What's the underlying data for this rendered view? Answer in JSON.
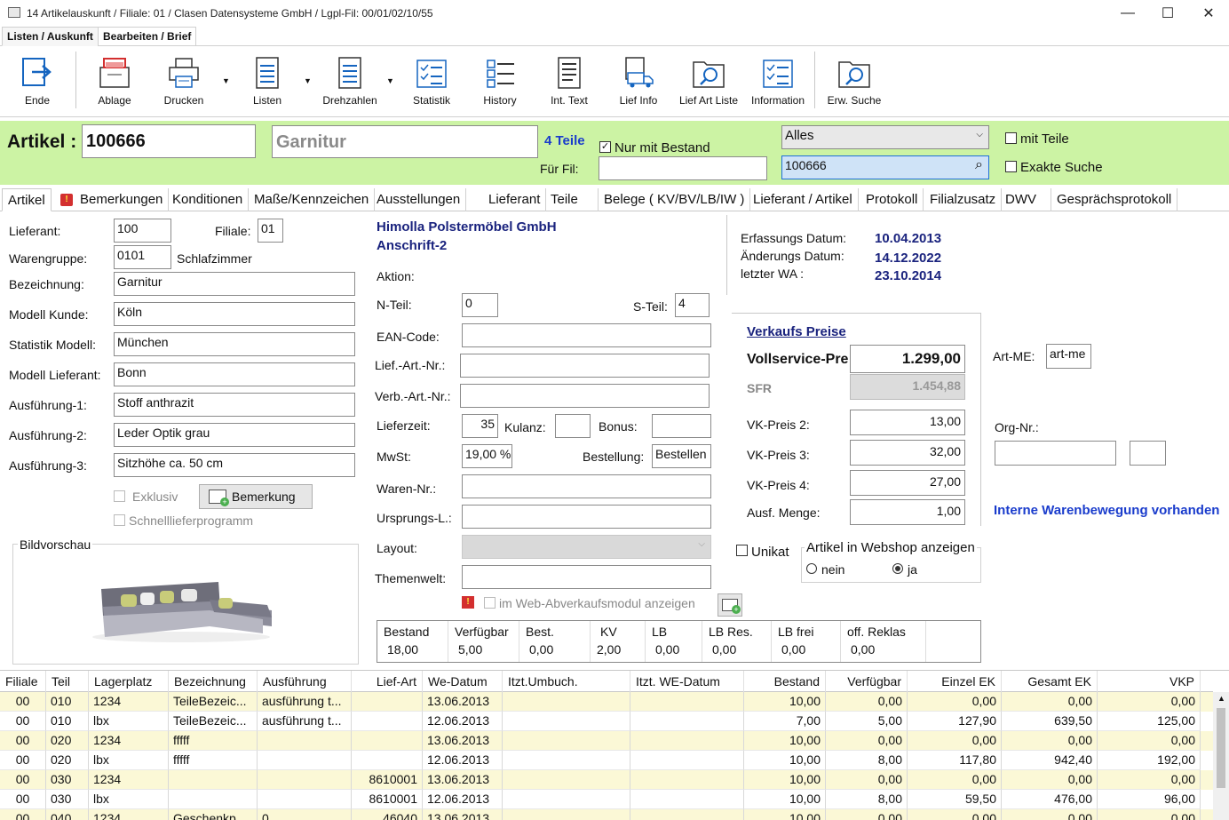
{
  "window": {
    "title": "14 Artikelauskunft / Filiale: 01 / Clasen Datensysteme GmbH / Lgpl-Fil: 00/01/02/10/55",
    "min": "—",
    "max": "☐",
    "close": "✕"
  },
  "ribbon_tabs": [
    "Listen / Auskunft",
    "Bearbeiten / Brief"
  ],
  "ribbon": {
    "ende": "Ende",
    "ablage": "Ablage",
    "drucken": "Drucken",
    "listen": "Listen",
    "drehzahlen": "Drehzahlen",
    "statistik": "Statistik",
    "history": "History",
    "int_text": "Int. Text",
    "lief_info": "Lief Info",
    "lief_art_liste": "Lief Art Liste",
    "information": "Information",
    "erw_suche": "Erw. Suche"
  },
  "header": {
    "artikel_label": "Artikel :",
    "artikel_nr": "100666",
    "bezeichnung": "Garnitur",
    "teile": "4 Teile",
    "nur_mit_bestand": "Nur mit Bestand",
    "fuer_fil_label": "Für Fil:",
    "fuer_fil_value": "",
    "filter": "Alles",
    "search_value": "100666",
    "mit_teile": "mit Teile",
    "exakte_suche": "Exakte Suche"
  },
  "tabs": [
    "Artikel",
    "Bemerkungen",
    "Konditionen",
    "Maße/Kennzeichen",
    "Ausstellungen",
    "Lieferant",
    "Teile",
    "Belege ( KV/BV/LB/IW )",
    "Lieferant / Artikel",
    "Protokoll",
    "Filialzusatz",
    "DWV",
    "Gesprächsprotokoll"
  ],
  "left": {
    "lieferant_label": "Lieferant:",
    "lieferant": "100",
    "filiale_label": "Filiale:",
    "filiale": "01",
    "warengruppe_label": "Warengruppe:",
    "warengruppe": "0101",
    "warengruppe_name": "Schlafzimmer",
    "bezeichnung_label": "Bezeichnung:",
    "bezeichnung": "Garnitur",
    "modell_kunde_label": "Modell Kunde:",
    "modell_kunde": "Köln",
    "statistik_modell_label": "Statistik Modell:",
    "statistik_modell": "München",
    "modell_lieferant_label": "Modell Lieferant:",
    "modell_lieferant": "Bonn",
    "ausf1_label": "Ausführung-1:",
    "ausf1": "Stoff anthrazit",
    "ausf2_label": "Ausführung-2:",
    "ausf2": "Leder Optik grau",
    "ausf3_label": "Ausführung-3:",
    "ausf3": "Sitzhöhe ca. 50 cm",
    "exklusiv": "Exklusiv",
    "bemerkung": "Bemerkung",
    "schnelllieferprogramm": "Schnelllieferprogramm",
    "bildvorschau": "Bildvorschau"
  },
  "middle": {
    "lieferant_name": "Himolla Polstermöbel GmbH",
    "anschrift": "Anschrift-2",
    "aktion_label": "Aktion:",
    "nteil_label": "N-Teil:",
    "nteil": "0",
    "steil_label": "S-Teil:",
    "steil": "4",
    "ean_label": "EAN-Code:",
    "ean": "",
    "lief_art_label": "Lief.-Art.-Nr.:",
    "lief_art": "",
    "verb_art_label": "Verb.-Art.-Nr.:",
    "verb_art": "",
    "lieferzeit_label": "Lieferzeit:",
    "lieferzeit": "35",
    "kulanz_label": "Kulanz:",
    "kulanz": "",
    "bonus_label": "Bonus:",
    "bonus": "",
    "mwst_label": "MwSt:",
    "mwst": "19,00 %",
    "bestellung_label": "Bestellung:",
    "bestellung": "Bestellen",
    "waren_label": "Waren-Nr.:",
    "waren": "",
    "ursprung_label": "Ursprungs-L.:",
    "ursprung": "",
    "layout_label": "Layout:",
    "layout": "",
    "themenwelt_label": "Themenwelt:",
    "themenwelt": "",
    "web_abverkauf": "im Web-Abverkaufsmodul anzeigen"
  },
  "stock": {
    "headers": [
      "Bestand",
      "Verfügbar",
      "Best.",
      "KV",
      "LB",
      "LB Res.",
      "LB frei",
      "off. Reklas"
    ],
    "values": [
      "18,00",
      "5,00",
      "0,00",
      "2,00",
      "0,00",
      "0,00",
      "0,00",
      "0,00"
    ]
  },
  "right": {
    "erfassung_label": "Erfassungs Datum:",
    "erfassung": "10.04.2013",
    "aenderung_label": "Änderungs Datum:",
    "aenderung": "14.12.2022",
    "letzter_wa_label": "letzter WA :",
    "letzter_wa": "23.10.2014",
    "verkaufs_preise": "Verkaufs Preise",
    "vollservice_label": "Vollservice-Pre",
    "vollservice": "1.299,00",
    "sfr_label": "SFR",
    "sfr": "1.454,88",
    "vk2_label": "VK-Preis 2:",
    "vk2": "13,00",
    "vk3_label": "VK-Preis 3:",
    "vk3": "32,00",
    "vk4_label": "VK-Preis 4:",
    "vk4": "27,00",
    "ausf_menge_label": "Ausf. Menge:",
    "ausf_menge": "1,00",
    "art_me_label": "Art-ME:",
    "art_me": "art-me",
    "org_nr_label": "Org-Nr.:",
    "org_nr": "",
    "org_nr2": "",
    "interne": "Interne Warenbewegung vorhanden",
    "unikat": "Unikat",
    "webshop_label": "Artikel in Webshop anzeigen",
    "nein": "nein",
    "ja": "ja"
  },
  "table": {
    "headers": [
      "Filiale",
      "Teil",
      "Lagerplatz",
      "Bezeichnung",
      "Ausführung",
      "Lief-Art",
      "We-Datum",
      "Itzt.Umbuch.",
      "Itzt. WE-Datum",
      "Bestand",
      "Verfügbar",
      "Einzel EK",
      "Gesamt EK",
      "VKP"
    ],
    "rows": [
      [
        "00",
        "010",
        "1234",
        "TeileBezeic...",
        "ausführung t...",
        "",
        "13.06.2013",
        "",
        "",
        "10,00",
        "0,00",
        "0,00",
        "0,00",
        "0,00"
      ],
      [
        "00",
        "010",
        "lbx",
        "TeileBezeic...",
        "ausführung t...",
        "",
        "12.06.2013",
        "",
        "",
        "7,00",
        "5,00",
        "127,90",
        "639,50",
        "125,00"
      ],
      [
        "00",
        "020",
        "1234",
        "fffff",
        "",
        "",
        "13.06.2013",
        "",
        "",
        "10,00",
        "0,00",
        "0,00",
        "0,00",
        "0,00"
      ],
      [
        "00",
        "020",
        "lbx",
        "fffff",
        "",
        "",
        "12.06.2013",
        "",
        "",
        "10,00",
        "8,00",
        "117,80",
        "942,40",
        "192,00"
      ],
      [
        "00",
        "030",
        "1234",
        "",
        "",
        "8610001",
        "13.06.2013",
        "",
        "",
        "10,00",
        "0,00",
        "0,00",
        "0,00",
        "0,00"
      ],
      [
        "00",
        "030",
        "lbx",
        "",
        "",
        "8610001",
        "12.06.2013",
        "",
        "",
        "10,00",
        "8,00",
        "59,50",
        "476,00",
        "96,00"
      ],
      [
        "00",
        "040",
        "1234",
        "Geschenkp...",
        "0",
        "46040",
        "13.06.2013",
        "",
        "",
        "10,00",
        "0,00",
        "0,00",
        "0,00",
        "0,00"
      ]
    ]
  },
  "colors": {
    "green": "#ccf3a4",
    "row_alt": "#fbf8d6",
    "title_blue": "#1a237e",
    "link_blue": "#1a3ccc"
  }
}
